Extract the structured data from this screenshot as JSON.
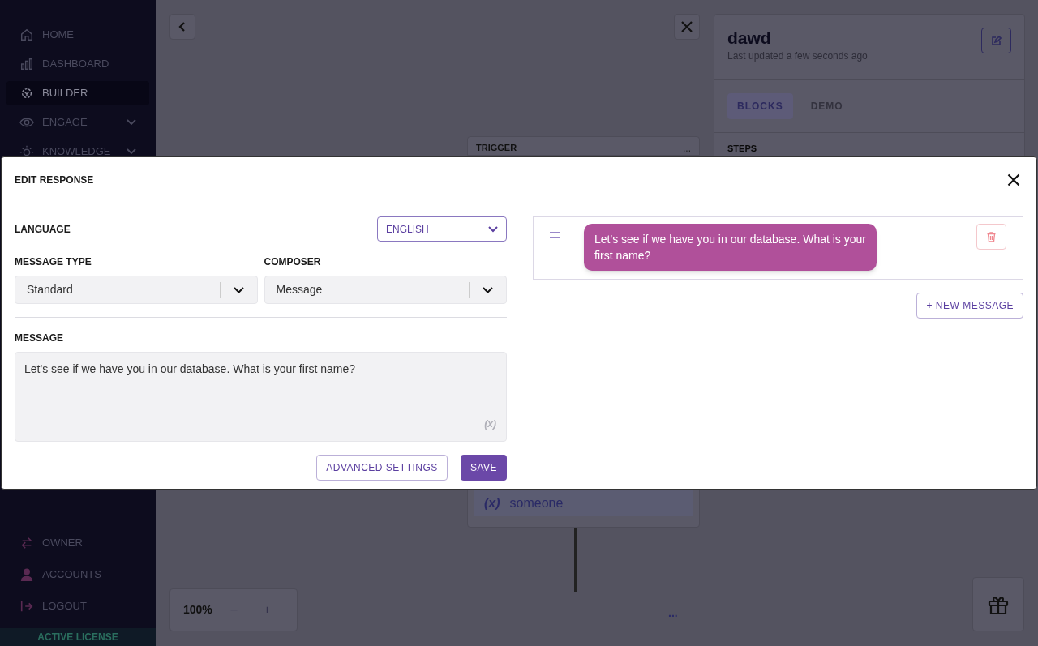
{
  "sidebar": {
    "items": [
      {
        "label": "HOME",
        "selected": false,
        "expandable": false
      },
      {
        "label": "DASHBOARD",
        "selected": false,
        "expandable": false
      },
      {
        "label": "BUILDER",
        "selected": true,
        "expandable": false
      },
      {
        "label": "ENGAGE",
        "selected": false,
        "expandable": true
      },
      {
        "label": "KNOWLEDGE",
        "selected": false,
        "expandable": true
      }
    ],
    "bottom_items": [
      {
        "label": "OWNER"
      },
      {
        "label": "ACCOUNTS"
      },
      {
        "label": "LOGOUT"
      }
    ],
    "license": "ACTIVE LICENSE"
  },
  "canvas": {
    "trigger_card": {
      "title": "TRIGGER",
      "menu": "..."
    },
    "variable_card": {
      "symbol": "(x)",
      "text": "someone"
    },
    "zoom": {
      "value": "100%",
      "minus": "−",
      "plus": "+"
    },
    "more": "..."
  },
  "right_panel": {
    "title": "dawd",
    "subtitle": "Last updated a few seconds ago",
    "tabs": [
      {
        "label": "BLOCKS",
        "selected": true
      },
      {
        "label": "DEMO",
        "selected": false
      }
    ],
    "section": "STEPS"
  },
  "modal": {
    "title": "EDIT RESPONSE",
    "language": {
      "label": "LANGUAGE",
      "value": "ENGLISH"
    },
    "message_type": {
      "label": "MESSAGE TYPE",
      "value": "Standard"
    },
    "composer": {
      "label": "COMPOSER",
      "value": "Message"
    },
    "message": {
      "label": "MESSAGE",
      "value": "Let's see if we have you in our database. What is your first name?",
      "variable_symbol": "(x)"
    },
    "buttons": {
      "advanced": "ADVANCED SETTINGS",
      "save": "SAVE"
    },
    "preview": {
      "messages": [
        {
          "text": "Let's see if we have you in our database. What is your first name?"
        }
      ],
      "new_message": "+ NEW MESSAGE"
    }
  }
}
